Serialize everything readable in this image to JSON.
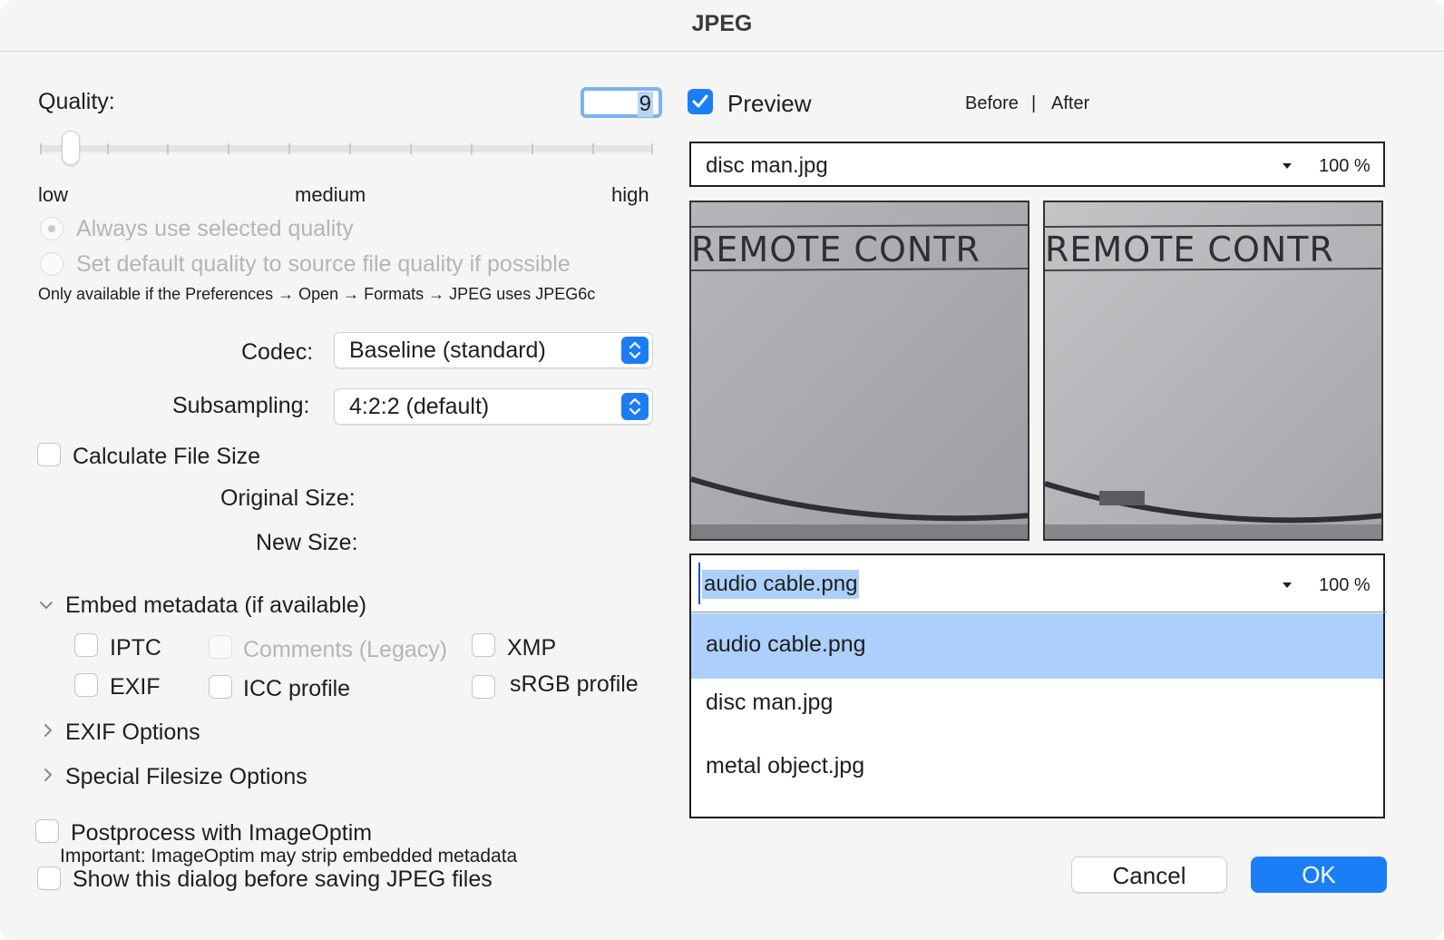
{
  "dialog": {
    "title": "JPEG"
  },
  "quality": {
    "label": "Quality:",
    "value": "9",
    "slider_level_fraction": 0.05,
    "low_label": "low",
    "medium_label": "medium",
    "high_label": "high",
    "radio_always": "Always use selected quality",
    "radio_default": "Set default quality to source file quality if possible",
    "note": "Only available if the Preferences → Open → Formats → JPEG uses JPEG6c"
  },
  "codec": {
    "label": "Codec:",
    "value": "Baseline (standard)"
  },
  "subsampling": {
    "label": "Subsampling:",
    "value": "4:2:2 (default)"
  },
  "filesize": {
    "calculate_label": "Calculate File Size",
    "original_label": "Original Size:",
    "new_label": "New Size:"
  },
  "metadata": {
    "header": "Embed metadata (if available)",
    "iptc": "IPTC",
    "comments": "Comments (Legacy)",
    "xmp": "XMP",
    "exif": "EXIF",
    "icc": "ICC profile",
    "srgb": "sRGB profile"
  },
  "sections": {
    "exif_options": "EXIF Options",
    "special_filesize": "Special Filesize Options"
  },
  "postprocess": {
    "label": "Postprocess with ImageOptim",
    "note": "Important: ImageOptim may strip embedded metadata",
    "show_dialog": "Show this dialog before saving JPEG files"
  },
  "preview": {
    "label": "Preview",
    "checked": true,
    "before": "Before",
    "separator": "|",
    "after": "After",
    "top_file": "disc man.jpg",
    "top_zoom": "100 %",
    "image_text": "REMOTE  CONTR",
    "bottom_file": "audio cable.png",
    "bottom_zoom": "100 %",
    "dropdown_options": [
      "audio cable.png",
      "disc man.jpg",
      "metal object.jpg"
    ]
  },
  "buttons": {
    "cancel": "Cancel",
    "ok": "OK"
  },
  "colors": {
    "accent": "#1b7ef6",
    "selection": "#acd0fb"
  }
}
